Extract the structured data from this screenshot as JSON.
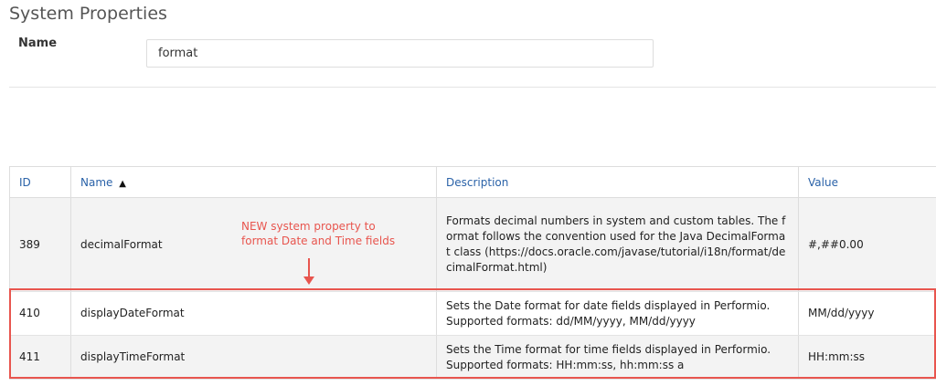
{
  "page": {
    "title": "System Properties"
  },
  "filter": {
    "name_label": "Name",
    "name_value": "format"
  },
  "table": {
    "headers": {
      "id": "ID",
      "name": "Name",
      "description": "Description",
      "value": "Value"
    },
    "sort_indicator": "▲",
    "rows": [
      {
        "id": "389",
        "name": "decimalFormat",
        "description": "Formats decimal numbers in system and custom tables. The format follows the convention used for the Java DecimalFormat class (https://docs.oracle.com/javase/tutorial/i18n/format/decimalFormat.html)",
        "value": "#,##0.00"
      },
      {
        "id": "410",
        "name": "displayDateFormat",
        "description": "Sets the Date format for date fields displayed in Performio. Supported formats: dd/MM/yyyy, MM/dd/yyyy",
        "value": "MM/dd/yyyy"
      },
      {
        "id": "411",
        "name": "displayTimeFormat",
        "description": "Sets the Time format for time fields displayed in Performio. Supported formats: HH:mm:ss, hh:mm:ss a",
        "value": "HH:mm:ss"
      }
    ]
  },
  "annotation": {
    "text": "NEW system property to format Date and Time fields"
  },
  "colors": {
    "annotation": "#e8554e",
    "header_text": "#2a62a8",
    "row_alt": "#f3f3f3"
  }
}
